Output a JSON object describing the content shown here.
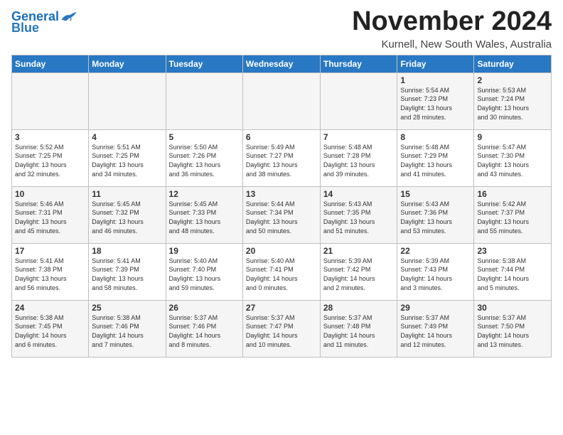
{
  "logo": {
    "line1": "General",
    "line2": "Blue"
  },
  "title": "November 2024",
  "subtitle": "Kurnell, New South Wales, Australia",
  "weekdays": [
    "Sunday",
    "Monday",
    "Tuesday",
    "Wednesday",
    "Thursday",
    "Friday",
    "Saturday"
  ],
  "weeks": [
    [
      {
        "day": "",
        "info": ""
      },
      {
        "day": "",
        "info": ""
      },
      {
        "day": "",
        "info": ""
      },
      {
        "day": "",
        "info": ""
      },
      {
        "day": "",
        "info": ""
      },
      {
        "day": "1",
        "info": "Sunrise: 5:54 AM\nSunset: 7:23 PM\nDaylight: 13 hours\nand 28 minutes."
      },
      {
        "day": "2",
        "info": "Sunrise: 5:53 AM\nSunset: 7:24 PM\nDaylight: 13 hours\nand 30 minutes."
      }
    ],
    [
      {
        "day": "3",
        "info": "Sunrise: 5:52 AM\nSunset: 7:25 PM\nDaylight: 13 hours\nand 32 minutes."
      },
      {
        "day": "4",
        "info": "Sunrise: 5:51 AM\nSunset: 7:25 PM\nDaylight: 13 hours\nand 34 minutes."
      },
      {
        "day": "5",
        "info": "Sunrise: 5:50 AM\nSunset: 7:26 PM\nDaylight: 13 hours\nand 36 minutes."
      },
      {
        "day": "6",
        "info": "Sunrise: 5:49 AM\nSunset: 7:27 PM\nDaylight: 13 hours\nand 38 minutes."
      },
      {
        "day": "7",
        "info": "Sunrise: 5:48 AM\nSunset: 7:28 PM\nDaylight: 13 hours\nand 39 minutes."
      },
      {
        "day": "8",
        "info": "Sunrise: 5:48 AM\nSunset: 7:29 PM\nDaylight: 13 hours\nand 41 minutes."
      },
      {
        "day": "9",
        "info": "Sunrise: 5:47 AM\nSunset: 7:30 PM\nDaylight: 13 hours\nand 43 minutes."
      }
    ],
    [
      {
        "day": "10",
        "info": "Sunrise: 5:46 AM\nSunset: 7:31 PM\nDaylight: 13 hours\nand 45 minutes."
      },
      {
        "day": "11",
        "info": "Sunrise: 5:45 AM\nSunset: 7:32 PM\nDaylight: 13 hours\nand 46 minutes."
      },
      {
        "day": "12",
        "info": "Sunrise: 5:45 AM\nSunset: 7:33 PM\nDaylight: 13 hours\nand 48 minutes."
      },
      {
        "day": "13",
        "info": "Sunrise: 5:44 AM\nSunset: 7:34 PM\nDaylight: 13 hours\nand 50 minutes."
      },
      {
        "day": "14",
        "info": "Sunrise: 5:43 AM\nSunset: 7:35 PM\nDaylight: 13 hours\nand 51 minutes."
      },
      {
        "day": "15",
        "info": "Sunrise: 5:43 AM\nSunset: 7:36 PM\nDaylight: 13 hours\nand 53 minutes."
      },
      {
        "day": "16",
        "info": "Sunrise: 5:42 AM\nSunset: 7:37 PM\nDaylight: 13 hours\nand 55 minutes."
      }
    ],
    [
      {
        "day": "17",
        "info": "Sunrise: 5:41 AM\nSunset: 7:38 PM\nDaylight: 13 hours\nand 56 minutes."
      },
      {
        "day": "18",
        "info": "Sunrise: 5:41 AM\nSunset: 7:39 PM\nDaylight: 13 hours\nand 58 minutes."
      },
      {
        "day": "19",
        "info": "Sunrise: 5:40 AM\nSunset: 7:40 PM\nDaylight: 13 hours\nand 59 minutes."
      },
      {
        "day": "20",
        "info": "Sunrise: 5:40 AM\nSunset: 7:41 PM\nDaylight: 14 hours\nand 0 minutes."
      },
      {
        "day": "21",
        "info": "Sunrise: 5:39 AM\nSunset: 7:42 PM\nDaylight: 14 hours\nand 2 minutes."
      },
      {
        "day": "22",
        "info": "Sunrise: 5:39 AM\nSunset: 7:43 PM\nDaylight: 14 hours\nand 3 minutes."
      },
      {
        "day": "23",
        "info": "Sunrise: 5:38 AM\nSunset: 7:44 PM\nDaylight: 14 hours\nand 5 minutes."
      }
    ],
    [
      {
        "day": "24",
        "info": "Sunrise: 5:38 AM\nSunset: 7:45 PM\nDaylight: 14 hours\nand 6 minutes."
      },
      {
        "day": "25",
        "info": "Sunrise: 5:38 AM\nSunset: 7:46 PM\nDaylight: 14 hours\nand 7 minutes."
      },
      {
        "day": "26",
        "info": "Sunrise: 5:37 AM\nSunset: 7:46 PM\nDaylight: 14 hours\nand 8 minutes."
      },
      {
        "day": "27",
        "info": "Sunrise: 5:37 AM\nSunset: 7:47 PM\nDaylight: 14 hours\nand 10 minutes."
      },
      {
        "day": "28",
        "info": "Sunrise: 5:37 AM\nSunset: 7:48 PM\nDaylight: 14 hours\nand 11 minutes."
      },
      {
        "day": "29",
        "info": "Sunrise: 5:37 AM\nSunset: 7:49 PM\nDaylight: 14 hours\nand 12 minutes."
      },
      {
        "day": "30",
        "info": "Sunrise: 5:37 AM\nSunset: 7:50 PM\nDaylight: 14 hours\nand 13 minutes."
      }
    ]
  ]
}
